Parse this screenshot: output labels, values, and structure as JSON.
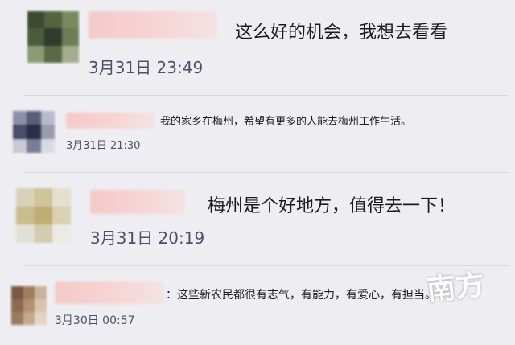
{
  "comments": [
    {
      "text": "这么好的机会，我想去看看",
      "time": "3月31日 23:49"
    },
    {
      "text": "我的家乡在梅州，希望有更多的人能去梅州工作生活。",
      "time": "3月31日 21:30"
    },
    {
      "text": "梅州是个好地方，值得去一下！",
      "time": "3月31日 20:19"
    },
    {
      "text": "：这些新农民都很有志气，有能力，有爱心，有担当。",
      "time": "3月30日 00:57"
    }
  ],
  "watermark": "南方",
  "colors": {
    "background": "#eeeef2",
    "time_text": "#4a5266",
    "blurred_name": "#f4c9c9"
  }
}
